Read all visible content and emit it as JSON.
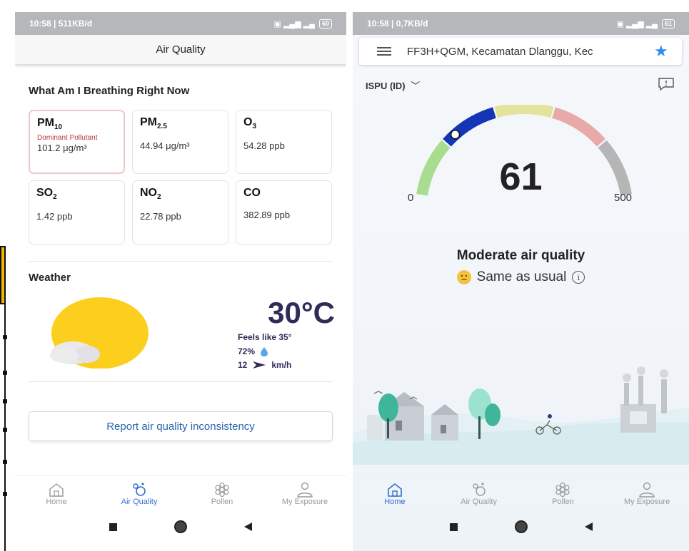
{
  "left": {
    "status": {
      "time": "10:58 | 511KB/d",
      "battery": "60"
    },
    "title": "Air Quality",
    "breathing": {
      "heading": "What Am I Breathing Right Now",
      "pollutants": [
        {
          "name": "PM",
          "sub": "10",
          "dominant": "Dominant Pollutant",
          "value": "101.2  μg/m³"
        },
        {
          "name": "PM",
          "sub": "2.5",
          "value": "44.94  μg/m³"
        },
        {
          "name": "O",
          "sub": "3",
          "value": "54.28  ppb"
        },
        {
          "name": "SO",
          "sub": "2",
          "value": "1.42  ppb"
        },
        {
          "name": "NO",
          "sub": "2",
          "value": "22.78  ppb"
        },
        {
          "name": "CO",
          "sub": "",
          "value": "382.89  ppb"
        }
      ]
    },
    "weather": {
      "heading": "Weather",
      "temperature": "30°C",
      "feels_like": "Feels like 35°",
      "humidity": "72%",
      "wind_speed": "12",
      "wind_unit": "km/h"
    },
    "report_label": "Report air quality inconsistency",
    "nav": [
      {
        "label": "Home",
        "icon": "home-icon",
        "active": false
      },
      {
        "label": "Air Quality",
        "icon": "air-quality-icon",
        "active": true
      },
      {
        "label": "Pollen",
        "icon": "pollen-icon",
        "active": false
      },
      {
        "label": "My Exposure",
        "icon": "person-icon",
        "active": false
      }
    ]
  },
  "right": {
    "status": {
      "time": "10:58 | 0,7KB/d",
      "battery": "61"
    },
    "location": "FF3H+QGM,  Kecamatan Dlanggu, Kec",
    "index_name": "ISPU (ID)",
    "aqi": {
      "value": "61",
      "min": "0",
      "max": "500",
      "level": 61,
      "scale_max": 500
    },
    "status_text": "Moderate air quality",
    "comparison": "Same as usual",
    "gauge_colors": [
      "#a8dc8e",
      "#1436b6",
      "#e3e39c",
      "#e8a9a9",
      "#b5b5b5"
    ],
    "nav": [
      {
        "label": "Home",
        "icon": "home-icon",
        "active": true
      },
      {
        "label": "Air Quality",
        "icon": "air-quality-icon",
        "active": false
      },
      {
        "label": "Pollen",
        "icon": "pollen-icon",
        "active": false
      },
      {
        "label": "My Exposure",
        "icon": "person-icon",
        "active": false
      }
    ]
  }
}
